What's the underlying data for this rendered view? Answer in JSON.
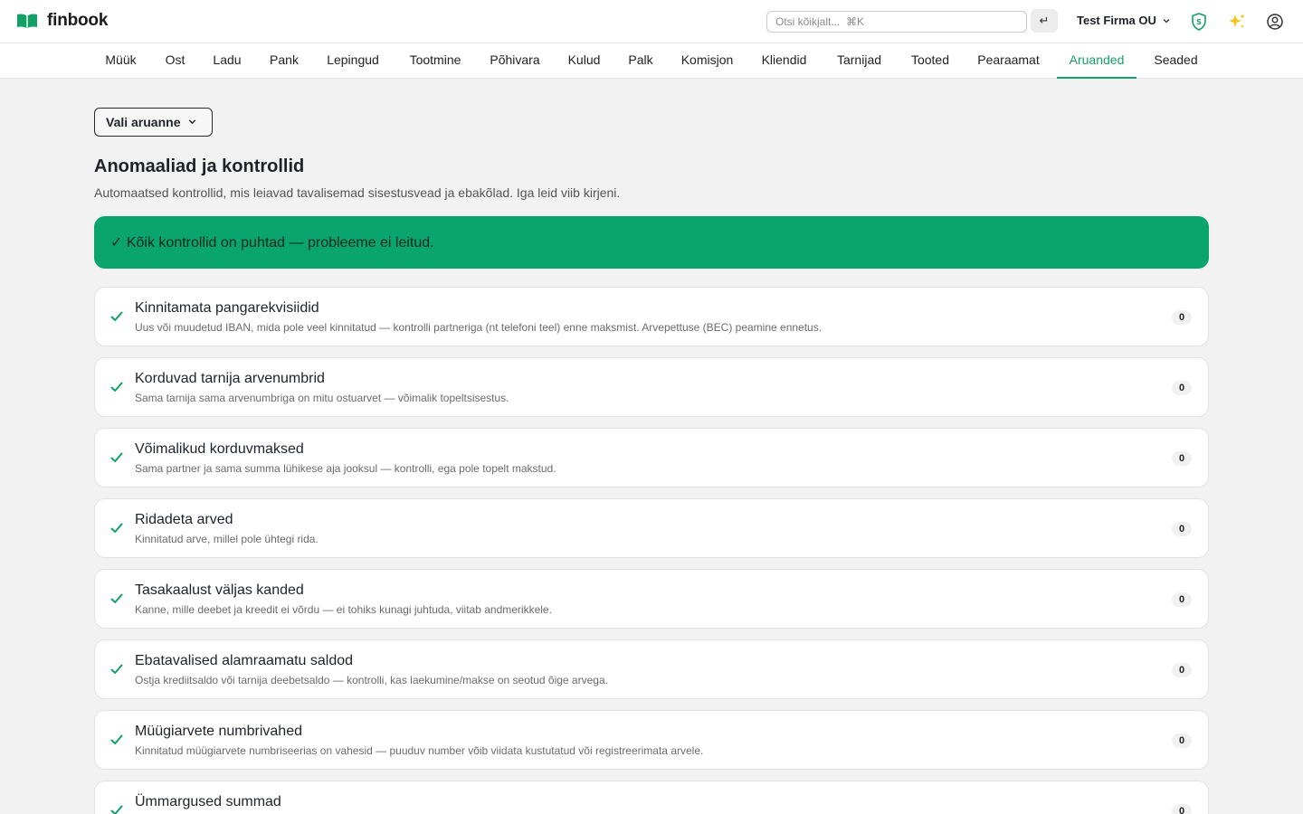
{
  "header": {
    "app_name": "finbook",
    "search_placeholder": "Otsi kõikjalt...  ⌘K",
    "enter_label": "↵",
    "company_name": "Test Firma OU"
  },
  "nav": {
    "active": "Aruanded",
    "items": [
      "Müük",
      "Ost",
      "Ladu",
      "Pank",
      "Lepingud",
      "Tootmine",
      "Põhivara",
      "Kulud",
      "Palk",
      "Komisjon",
      "Kliendid",
      "Tarnijad",
      "Tooted",
      "Pearaamat",
      "Aruanded",
      "Seaded"
    ]
  },
  "main": {
    "report_select_label": "Vali aruanne",
    "title": "Anomaaliad ja kontrollid",
    "description": "Automaatsed kontrollid, mis leiavad tavalisemad sisestusvead ja ebakõlad. Iga leid viib kirjeni.",
    "success_message": "✓ Kõik kontrollid on puhtad — probleeme ei leitud.",
    "checks": [
      {
        "title": "Kinnitamata pangarekvisiidid",
        "description": "Uus või muudetud IBAN, mida pole veel kinnitatud — kontrolli partneriga (nt telefoni teel) enne maksmist. Arvepettuse (BEC) peamine ennetus.",
        "count": "0"
      },
      {
        "title": "Korduvad tarnija arvenumbrid",
        "description": "Sama tarnija sama arvenumbriga on mitu ostuarvet — võimalik topeltsisestus.",
        "count": "0"
      },
      {
        "title": "Võimalikud korduvmaksed",
        "description": "Sama partner ja sama summa lühikese aja jooksul — kontrolli, ega pole topelt makstud.",
        "count": "0"
      },
      {
        "title": "Ridadeta arved",
        "description": "Kinnitatud arve, millel pole ühtegi rida.",
        "count": "0"
      },
      {
        "title": "Tasakaalust väljas kanded",
        "description": "Kanne, mille deebet ja kreedit ei võrdu — ei tohiks kunagi juhtuda, viitab andmerikkele.",
        "count": "0"
      },
      {
        "title": "Ebatavalised alamraamatu saldod",
        "description": "Ostja krediitsaldo või tarnija deebetsaldo — kontrolli, kas laekumine/makse on seotud õige arvega.",
        "count": "0"
      },
      {
        "title": "Müügiarvete numbrivahed",
        "description": "Kinnitatud müügiarvete numbriseerias on vahesid — puuduv number võib viidata kustutatud või registreerimata arvele.",
        "count": "0"
      },
      {
        "title": "Ümmargused summad",
        "description": "",
        "count": "0"
      }
    ]
  }
}
